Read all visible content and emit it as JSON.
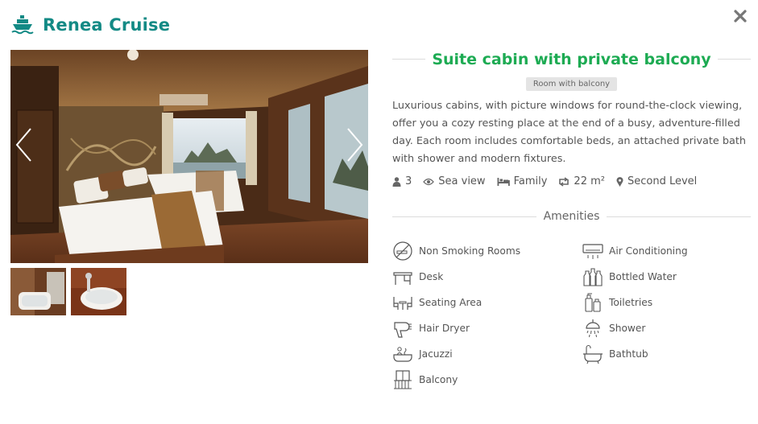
{
  "header": {
    "brand": "Renea Cruise",
    "ship_icon": "cruise-ship-icon",
    "close_icon": "close-icon"
  },
  "room": {
    "title": "Suite cabin with private balcony",
    "tag": "Room with balcony",
    "description": "Luxurious cabins, with picture windows for round-the-clock viewing, offer you a cozy resting place at the end of a busy, adventure-filled day. Each room includes comfortable beds, an attached private bath with shower and modern fixtures."
  },
  "specs": {
    "guests": "3",
    "view": "Sea view",
    "bed": "Family",
    "size": "22 m²",
    "level": "Second Level"
  },
  "amenities_title": "Amenities",
  "amenities": [
    {
      "label": "Non Smoking Rooms",
      "icon": "no-smoking-icon"
    },
    {
      "label": "Air Conditioning",
      "icon": "air-conditioner-icon"
    },
    {
      "label": "Desk",
      "icon": "desk-icon"
    },
    {
      "label": "Bottled Water",
      "icon": "bottled-water-icon"
    },
    {
      "label": "Seating Area",
      "icon": "seating-area-icon"
    },
    {
      "label": "Toiletries",
      "icon": "toiletries-icon"
    },
    {
      "label": "Hair Dryer",
      "icon": "hair-dryer-icon"
    },
    {
      "label": "Shower",
      "icon": "shower-icon"
    },
    {
      "label": "Jacuzzi",
      "icon": "jacuzzi-icon"
    },
    {
      "label": "Bathtub",
      "icon": "bathtub-icon"
    },
    {
      "label": "Balcony",
      "icon": "balcony-icon"
    }
  ],
  "colors": {
    "brand": "#138a85",
    "title": "#1dab53"
  }
}
